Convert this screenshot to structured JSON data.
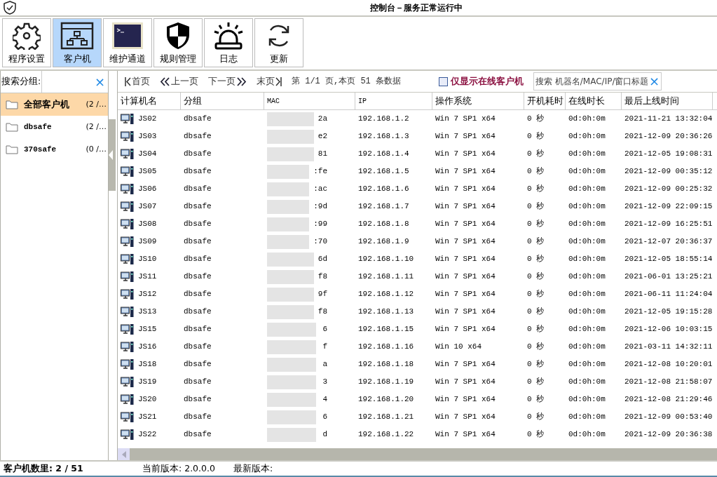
{
  "window": {
    "title": "控制台－服务正常运行中"
  },
  "toolbar": [
    {
      "label": "程序设置",
      "kind": "gear",
      "selected": false
    },
    {
      "label": "客户机",
      "kind": "network",
      "selected": true
    },
    {
      "label": "维护通道",
      "kind": "terminal",
      "selected": false
    },
    {
      "label": "规则管理",
      "kind": "shield",
      "selected": false
    },
    {
      "label": "日志",
      "kind": "alarm",
      "selected": false
    },
    {
      "label": "更新",
      "kind": "refresh",
      "selected": false
    }
  ],
  "sidebar": {
    "search_label": "搜索分组:",
    "clear": "×",
    "groups": [
      {
        "name": "全部客户机",
        "count": "(2 /…",
        "selected": true
      },
      {
        "name": "dbsafe",
        "count": "(2 /…",
        "selected": false
      },
      {
        "name": "370safe",
        "count": "(0 /…",
        "selected": false
      }
    ]
  },
  "pager": {
    "first": "首页",
    "prev": "上一页",
    "next": "下一页",
    "last": "末页",
    "info": "第 1/1 页,本页 51 条数据",
    "online_only": {
      "label": "仅显示在线客户机",
      "checked": false
    },
    "search_placeholder": "搜索 机器名/MAC/IP/窗口标题",
    "clear": "×"
  },
  "table": {
    "columns": [
      "计算机名",
      "分组",
      "MAC",
      "IP",
      "操作系统",
      "开机耗时",
      "在线时长",
      "最后上线时间"
    ],
    "rows": [
      [
        "JS02",
        "dbsafe",
        "2a",
        "192.168.1.2",
        "Win 7 SP1 x64",
        "0 秒",
        "0d:0h:0m",
        "2021-11-21 13:32:04"
      ],
      [
        "JS03",
        "dbsafe",
        "e2",
        "192.168.1.3",
        "Win 7 SP1 x64",
        "0 秒",
        "0d:0h:0m",
        "2021-12-09 20:36:26"
      ],
      [
        "JS04",
        "dbsafe",
        "81",
        "192.168.1.4",
        "Win 7 SP1 x64",
        "0 秒",
        "0d:0h:0m",
        "2021-12-05 19:08:31"
      ],
      [
        "JS05",
        "dbsafe",
        ":fe",
        "192.168.1.5",
        "Win 7 SP1 x64",
        "0 秒",
        "0d:0h:0m",
        "2021-12-09 00:35:12"
      ],
      [
        "JS06",
        "dbsafe",
        ":ac",
        "192.168.1.6",
        "Win 7 SP1 x64",
        "0 秒",
        "0d:0h:0m",
        "2021-12-09 00:25:32"
      ],
      [
        "JS07",
        "dbsafe",
        ":9d",
        "192.168.1.7",
        "Win 7 SP1 x64",
        "0 秒",
        "0d:0h:0m",
        "2021-12-09 22:09:15"
      ],
      [
        "JS08",
        "dbsafe",
        ":99",
        "192.168.1.8",
        "Win 7 SP1 x64",
        "0 秒",
        "0d:0h:0m",
        "2021-12-09 16:25:51"
      ],
      [
        "JS09",
        "dbsafe",
        ":70",
        "192.168.1.9",
        "Win 7 SP1 x64",
        "0 秒",
        "0d:0h:0m",
        "2021-12-07 20:36:37"
      ],
      [
        "JS10",
        "dbsafe",
        "6d",
        "192.168.1.10",
        "Win 7 SP1 x64",
        "0 秒",
        "0d:0h:0m",
        "2021-12-05 18:55:14"
      ],
      [
        "JS11",
        "dbsafe",
        "f8",
        "192.168.1.11",
        "Win 7 SP1 x64",
        "0 秒",
        "0d:0h:0m",
        "2021-06-01 13:25:21"
      ],
      [
        "JS12",
        "dbsafe",
        "9f",
        "192.168.1.12",
        "Win 7 SP1 x64",
        "0 秒",
        "0d:0h:0m",
        "2021-06-11 11:24:04"
      ],
      [
        "JS13",
        "dbsafe",
        "f8",
        "192.168.1.13",
        "Win 7 SP1 x64",
        "0 秒",
        "0d:0h:0m",
        "2021-12-05 19:15:28"
      ],
      [
        "JS15",
        "dbsafe",
        "6",
        "192.168.1.15",
        "Win 7 SP1 x64",
        "0 秒",
        "0d:0h:0m",
        "2021-12-06 10:03:15"
      ],
      [
        "JS16",
        "dbsafe",
        "f",
        "192.168.1.16",
        "Win 10 x64",
        "0 秒",
        "0d:0h:0m",
        "2021-03-11 14:32:11"
      ],
      [
        "JS18",
        "dbsafe",
        "a",
        "192.168.1.18",
        "Win 7 SP1 x64",
        "0 秒",
        "0d:0h:0m",
        "2021-12-08 10:20:01"
      ],
      [
        "JS19",
        "dbsafe",
        "3",
        "192.168.1.19",
        "Win 7 SP1 x64",
        "0 秒",
        "0d:0h:0m",
        "2021-12-08 21:58:07"
      ],
      [
        "JS20",
        "dbsafe",
        "4",
        "192.168.1.20",
        "Win 7 SP1 x64",
        "0 秒",
        "0d:0h:0m",
        "2021-12-08 21:29:46"
      ],
      [
        "JS21",
        "dbsafe",
        "6",
        "192.168.1.21",
        "Win 7 SP1 x64",
        "0 秒",
        "0d:0h:0m",
        "2021-12-09 00:53:40"
      ],
      [
        "JS22",
        "dbsafe",
        "d",
        "192.168.1.22",
        "Win 7 SP1 x64",
        "0 秒",
        "0d:0h:0m",
        "2021-12-09 20:36:38"
      ]
    ]
  },
  "status_bar": {
    "count": "客户机数里: 2 / 51",
    "version": "当前版本: 2.0.0.0",
    "latest": "最新版本:"
  }
}
